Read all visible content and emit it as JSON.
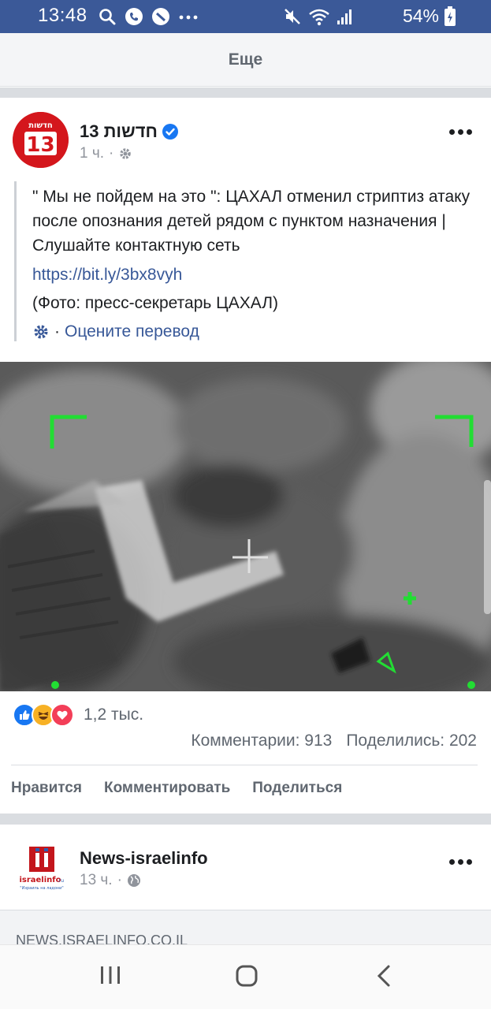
{
  "status_bar": {
    "time": "13:48",
    "battery_percent": "54%",
    "left_icons": [
      "search-icon",
      "phone-icon",
      "pin-icon",
      "more-notifications-icon"
    ],
    "right_icons": [
      "mute-icon",
      "wifi-icon",
      "signal-icon",
      "battery-icon"
    ],
    "background": "#3b5998"
  },
  "header": {
    "title": "Еще"
  },
  "posts": [
    {
      "page_name": "חדשות 13",
      "avatar_text": "חדשות",
      "avatar_number": "13",
      "time": "1 ч.",
      "audience_icon": "gear-icon",
      "text": "\" Мы не пойдем на это \": ЦАХАЛ отменил стриптиз атаку после опознания детей рядом с пунктом назначения | Слушайте контактную сеть",
      "link": "https://bit.ly/3bx8vyh",
      "caption": "(Фото: пресс-секретарь ЦАХАЛ)",
      "translate_prefix": "·",
      "translate_label": "Оцените перевод",
      "reactions_count": "1,2 тыс.",
      "comments": "Комментарии: 913",
      "shares": "Поделились: 202",
      "actions": {
        "like": "Нравится",
        "comment": "Комментировать",
        "share": "Поделиться"
      }
    },
    {
      "page_name": "News-israelinfo",
      "avatar_brand": "israelinfo",
      "avatar_brand_tld": ".ru",
      "avatar_slogan": "\"Израиль на ладони\"",
      "time": "13 ч.",
      "audience_icon": "globe-icon",
      "link_domain": "NEWS.ISRAELINFO.CO.IL"
    }
  ],
  "colors": {
    "facebook_blue": "#3b5998",
    "link": "#385898",
    "verified": "#1877f2",
    "avatar_red": "#d4161c",
    "target_green": "#22dd33"
  }
}
